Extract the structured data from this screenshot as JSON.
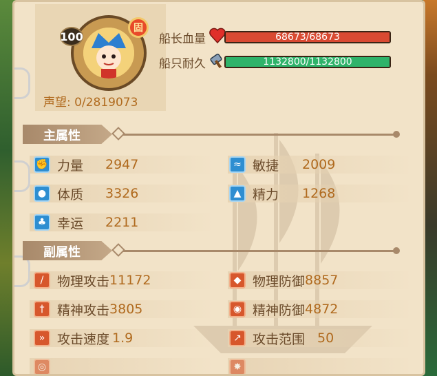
{
  "avatar": {
    "level": "100",
    "rank_badge": "固",
    "fame_label": "声望:",
    "fame_value": "0/2819073"
  },
  "status": {
    "captain_hp_label": "船长血量",
    "captain_hp_value": "68673/68673",
    "captain_hp_fraction": 1.0,
    "ship_durability_label": "船只耐久",
    "ship_durability_value": "1132800/1132800",
    "ship_durability_fraction": 1.0
  },
  "primary": {
    "title": "主属性",
    "items": [
      {
        "icon": "fist-icon",
        "name": "力量",
        "value": "2947"
      },
      {
        "icon": "feather-icon",
        "name": "敏捷",
        "value": "2009"
      },
      {
        "icon": "person-icon",
        "name": "体质",
        "value": "3326"
      },
      {
        "icon": "scholar-hat-icon",
        "name": "精力",
        "value": "1268"
      },
      {
        "icon": "clover-icon",
        "name": "幸运",
        "value": "2211"
      }
    ]
  },
  "secondary": {
    "title": "副属性",
    "items": [
      {
        "icon": "sword-icon",
        "name": "物理攻击",
        "value": "11172"
      },
      {
        "icon": "shield-icon",
        "name": "物理防御",
        "value": "8857"
      },
      {
        "icon": "staff-icon",
        "name": "精神攻击",
        "value": "3805"
      },
      {
        "icon": "magic-shield-icon",
        "name": "精神防御",
        "value": "4872"
      },
      {
        "icon": "speed-sword-icon",
        "name": "攻击速度",
        "value": "1.9"
      },
      {
        "icon": "range-icon",
        "name": "攻击范围",
        "value": "50"
      }
    ]
  },
  "colors": {
    "hp_bar": "#d94a32",
    "durability_bar": "#2fb36a",
    "label": "#6a4a2a",
    "value": "#b06a1e"
  }
}
